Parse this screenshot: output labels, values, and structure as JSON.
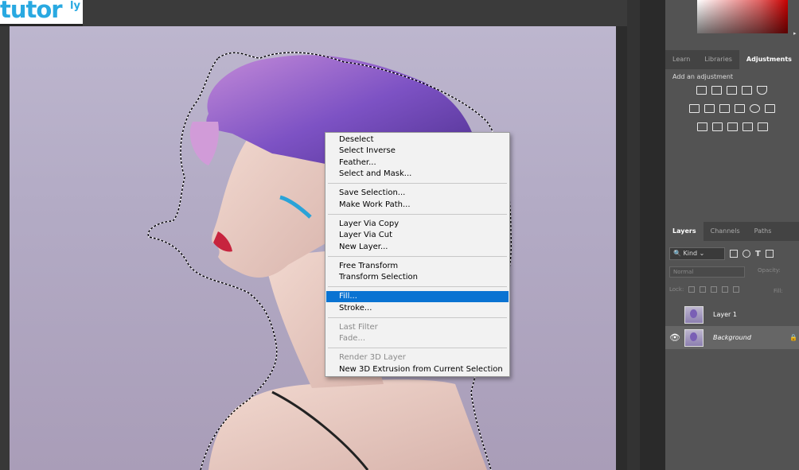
{
  "logo": {
    "text": "tutor",
    "sup": "ly"
  },
  "panel_tabs_top": [
    {
      "label": "Learn"
    },
    {
      "label": "Libraries"
    },
    {
      "label": "Adjustments"
    }
  ],
  "adjustments": {
    "label": "Add an adjustment"
  },
  "layers_tabs": [
    {
      "label": "Layers"
    },
    {
      "label": "Channels"
    },
    {
      "label": "Paths"
    }
  ],
  "layers_panel": {
    "kind_label": "Kind",
    "blend_mode": "Normal",
    "opacity_label": "Opacity:",
    "lock_label": "Lock:",
    "fill_label": "Fill:",
    "layers": [
      {
        "name": "Layer 1"
      },
      {
        "name": "Background"
      }
    ]
  },
  "context_menu": {
    "items": [
      {
        "label": "Deselect"
      },
      {
        "label": "Select Inverse"
      },
      {
        "label": "Feather..."
      },
      {
        "label": "Select and Mask..."
      },
      {
        "label": "Save Selection..."
      },
      {
        "label": "Make Work Path..."
      },
      {
        "label": "Layer Via Copy"
      },
      {
        "label": "Layer Via Cut"
      },
      {
        "label": "New Layer..."
      },
      {
        "label": "Free Transform"
      },
      {
        "label": "Transform Selection"
      },
      {
        "label": "Fill..."
      },
      {
        "label": "Stroke..."
      },
      {
        "label": "Last Filter"
      },
      {
        "label": "Fade..."
      },
      {
        "label": "Render 3D Layer"
      },
      {
        "label": "New 3D Extrusion from Current Selection"
      }
    ],
    "highlighted": "Fill..."
  },
  "colors": {
    "accent": "#0a73d2",
    "menu_bg": "#f2f2f2",
    "panel_bg": "#535353"
  }
}
